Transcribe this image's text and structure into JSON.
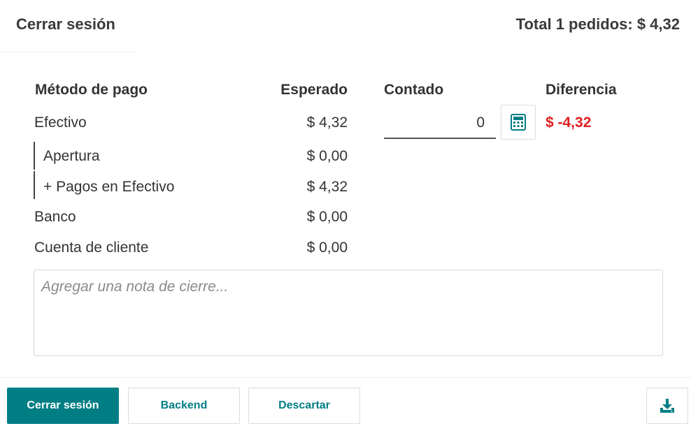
{
  "header": {
    "title": "Cerrar sesión",
    "total": "Total 1 pedidos: $ 4,32"
  },
  "table": {
    "columns": {
      "method": "Método de pago",
      "expected": "Esperado",
      "counted": "Contado",
      "difference": "Diferencia"
    },
    "cash": {
      "label": "Efectivo",
      "expected": "$ 4,32",
      "counted_value": "0",
      "difference": "$ -4,32",
      "breakdown": [
        {
          "label": "Apertura",
          "amount": "$ 0,00"
        },
        {
          "label": "+ Pagos en Efectivo",
          "amount": "$ 4,32"
        }
      ]
    },
    "rows": [
      {
        "label": "Banco",
        "expected": "$ 0,00"
      },
      {
        "label": "Cuenta de cliente",
        "expected": "$ 0,00"
      }
    ]
  },
  "note": {
    "placeholder": "Agregar una nota de cierre..."
  },
  "footer": {
    "close_label": "Cerrar sesión",
    "backend_label": "Backend",
    "discard_label": "Descartar",
    "download_icon": "download-icon"
  },
  "colors": {
    "primary": "#017e84",
    "negative": "#e02020"
  },
  "icons": {
    "calculator": "calculator-icon"
  }
}
